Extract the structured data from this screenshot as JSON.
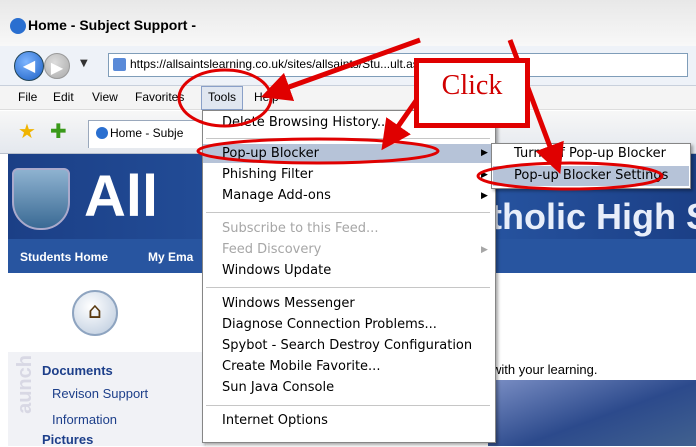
{
  "window": {
    "title": "Home - Subject Support -"
  },
  "address_bar": {
    "url": "https://allsaintslearning.co.uk/sites/allsaints/Stu...ult.aspx"
  },
  "menu_bar": {
    "items": [
      "File",
      "Edit",
      "View",
      "Favorites",
      "Tools",
      "Help"
    ]
  },
  "tab": {
    "label": "Home - Subje"
  },
  "tools_menu": {
    "items": [
      {
        "label": "Delete Browsing History...",
        "enabled": true
      },
      {
        "label": "Pop-up Blocker",
        "enabled": true,
        "submenu": true
      },
      {
        "label": "Phishing Filter",
        "enabled": true,
        "submenu": true
      },
      {
        "label": "Manage Add-ons",
        "enabled": true,
        "submenu": true
      },
      {
        "label": "Subscribe to this Feed...",
        "enabled": false
      },
      {
        "label": "Feed Discovery",
        "enabled": false,
        "submenu": true
      },
      {
        "label": "Windows Update",
        "enabled": true
      },
      {
        "label": "Windows Messenger",
        "enabled": true
      },
      {
        "label": "Diagnose Connection Problems...",
        "enabled": true
      },
      {
        "label": "Spybot - Search  Destroy Configuration",
        "enabled": true
      },
      {
        "label": "Create Mobile Favorite...",
        "enabled": true
      },
      {
        "label": "Sun Java Console",
        "enabled": true
      },
      {
        "label": "Internet Options",
        "enabled": true
      }
    ]
  },
  "popup_submenu": {
    "items": [
      "Turn Off Pop-up Blocker",
      "Pop-up Blocker Settings"
    ]
  },
  "annotation": {
    "callout": "Click",
    "color": "#e00000"
  },
  "site": {
    "banner_left": "All",
    "banner_right": "tholic High S",
    "nav": [
      "Students Home",
      "My Ema"
    ],
    "sidebar": [
      "Documents",
      "Revison Support",
      "Information",
      "Pictures"
    ],
    "sidebar_vertical": "aunch",
    "welcome": "with your learning."
  },
  "colors": {
    "banner": "#2a5aa8",
    "menu_highlight": "#b6c3d8"
  }
}
